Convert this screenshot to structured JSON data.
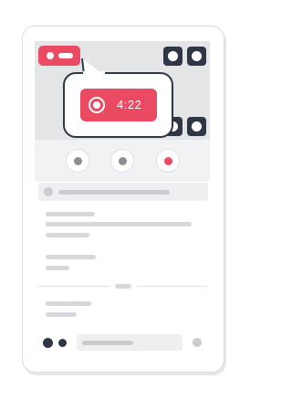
{
  "recorder": {
    "timer": "4:22"
  },
  "colors": {
    "accent": "#ea4a62",
    "dark": "#2f3746",
    "muted": "#d6d8db"
  },
  "icons": {
    "record": "record-icon",
    "corner": "corner-handle-icon"
  }
}
